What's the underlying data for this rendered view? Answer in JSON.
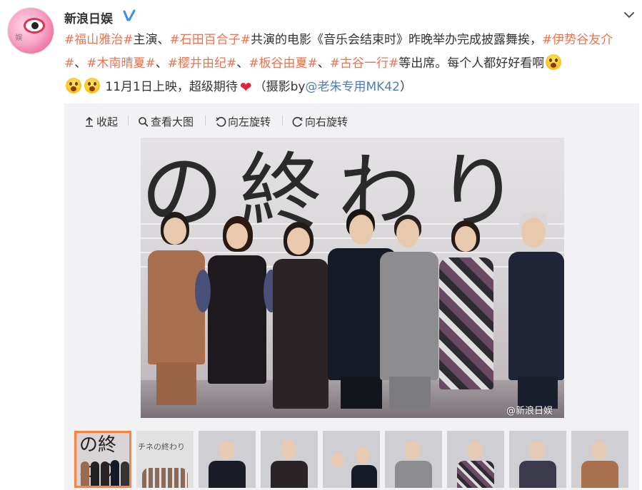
{
  "user": {
    "name": "新浪日娱",
    "avatar_text": "娱",
    "verified": true
  },
  "post": {
    "t1": "#福山雅治#",
    "t2": "主演、",
    "t3": "#石田百合子#",
    "t4": "共演的电影《音乐会结束时》昨晚举办完成披露舞挨，",
    "t5": "#伊势谷友介#",
    "t6": "、",
    "t7": "#木南晴夏#",
    "t8": "、",
    "t9": "#樱井由纪#",
    "t10": "、",
    "t11": "#板谷由夏#",
    "t12": "、",
    "t13": "#古谷一行#",
    "t14": "等出席。每个人都好好看啊",
    "t15": "11月1日上映，超级期待",
    "t16": "（摄影by",
    "t17": "@老朱专用MK42",
    "t18": "）"
  },
  "toolbar": {
    "collapse": "收起",
    "view_large": "查看大图",
    "rotate_left": "向左旋转",
    "rotate_right": "向右旋转"
  },
  "photo": {
    "banner_text": "の終わり",
    "watermark": "@新浪日娱"
  },
  "thumbnails": {
    "count": 9,
    "active_index": 0,
    "thumb2_text": "チネの終わり"
  },
  "colors": {
    "link": "#eb7350",
    "accent_border": "#ff8140",
    "mention": "#507daf"
  }
}
